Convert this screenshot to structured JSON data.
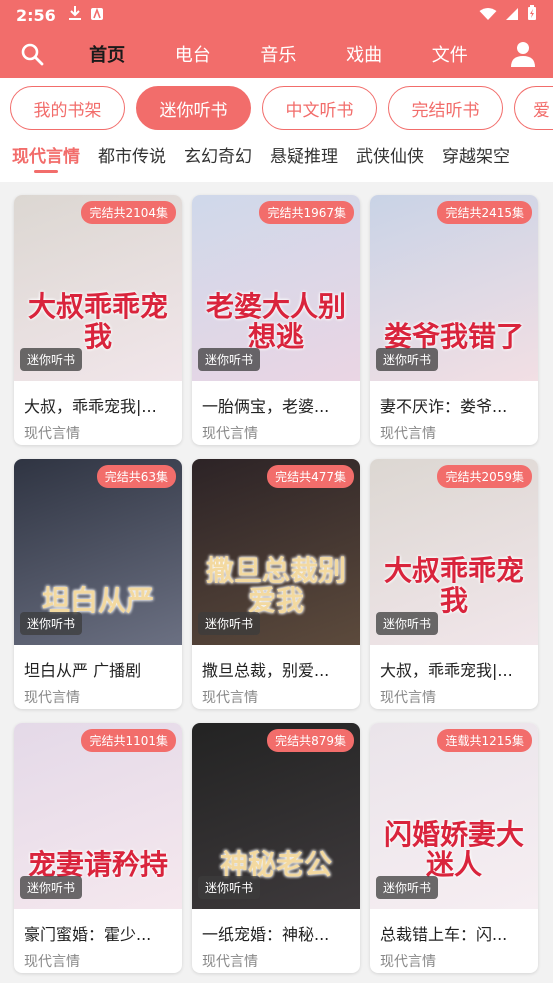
{
  "status_bar": {
    "time": "2:56"
  },
  "nav": {
    "tabs": [
      {
        "label": "首页",
        "active": true
      },
      {
        "label": "电台",
        "active": false
      },
      {
        "label": "音乐",
        "active": false
      },
      {
        "label": "戏曲",
        "active": false
      },
      {
        "label": "文件",
        "active": false
      }
    ]
  },
  "pills": [
    {
      "label": "我的书架",
      "active": false
    },
    {
      "label": "迷你听书",
      "active": true
    },
    {
      "label": "中文听书",
      "active": false
    },
    {
      "label": "完结听书",
      "active": false
    },
    {
      "label": "爱",
      "active": false,
      "partial": true
    }
  ],
  "categories": [
    {
      "label": "现代言情",
      "active": true
    },
    {
      "label": "都市传说",
      "active": false
    },
    {
      "label": "玄幻奇幻",
      "active": false
    },
    {
      "label": "悬疑推理",
      "active": false
    },
    {
      "label": "武侠仙侠",
      "active": false
    },
    {
      "label": "穿越架空",
      "active": false
    }
  ],
  "cards": [
    {
      "title": "大叔，乖乖宠我|...",
      "category": "现代言情",
      "badge": "完结共2104集",
      "tag": "迷你听书",
      "cover_text": "大叔乖乖宠我",
      "colors": [
        "#dcd7d2",
        "#f1e6ea"
      ]
    },
    {
      "title": "一胎俩宝，老婆...",
      "category": "现代言情",
      "badge": "完结共1967集",
      "tag": "迷你听书",
      "cover_text": "老婆大人别想逃",
      "colors": [
        "#cfd8ea",
        "#ead6e4"
      ]
    },
    {
      "title": "妻不厌诈：娄爷...",
      "category": "现代言情",
      "badge": "完结共2415集",
      "tag": "迷你听书",
      "cover_text": "娄爷我错了",
      "colors": [
        "#c9d3e6",
        "#f2dfe4"
      ]
    },
    {
      "title": "坦白从严 广播剧",
      "category": "现代言情",
      "badge": "完结共63集",
      "tag": "迷你听书",
      "cover_text": "坦白从严",
      "colors": [
        "#2f3442",
        "#6b7082"
      ]
    },
    {
      "title": "撒旦总裁，别爱...",
      "category": "现代言情",
      "badge": "完结共477集",
      "tag": "迷你听书",
      "cover_text": "撒旦总裁别爱我",
      "colors": [
        "#2c2326",
        "#5c4a3c"
      ]
    },
    {
      "title": "大叔，乖乖宠我|...",
      "category": "现代言情",
      "badge": "完结共2059集",
      "tag": "迷你听书",
      "cover_text": "大叔乖乖宠我",
      "colors": [
        "#dcd7d2",
        "#f1e6ea"
      ]
    },
    {
      "title": "豪门蜜婚：霍少...",
      "category": "现代言情",
      "badge": "完结共1101集",
      "tag": "迷你听书",
      "cover_text": "宠妻请矜持",
      "colors": [
        "#e4d9e8",
        "#f5e8ee"
      ]
    },
    {
      "title": "一纸宠婚：神秘...",
      "category": "现代言情",
      "badge": "完结共879集",
      "tag": "迷你听书",
      "cover_text": "神秘老公",
      "colors": [
        "#232323",
        "#3e3a3c"
      ]
    },
    {
      "title": "总裁错上车：闪...",
      "category": "现代言情",
      "badge": "连载共1215集",
      "tag": "迷你听书",
      "cover_text": "闪婚娇妻大迷人",
      "colors": [
        "#eae4ea",
        "#f6eef2"
      ]
    }
  ]
}
